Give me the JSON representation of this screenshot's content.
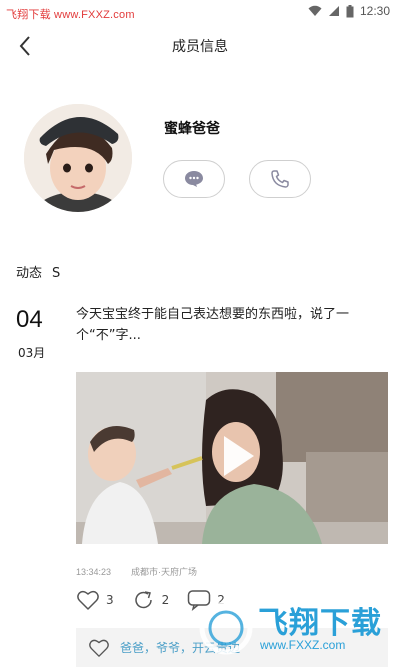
{
  "statusbar": {
    "watermark": "飞翔下载 www.FXXZ.com",
    "time": "12:30"
  },
  "navbar": {
    "title": "成员信息"
  },
  "profile": {
    "name": "蜜蜂爸爸"
  },
  "feed": {
    "label": "动态",
    "count": "S",
    "post": {
      "day": "04",
      "month": "03月",
      "text": "今天宝宝终于能自己表达想要的东西啦，说了一个“不”字...",
      "time": "13:34:23",
      "location": "成都市·天府广场",
      "likes": "3",
      "shares": "2",
      "comments": "2",
      "liked_by": "爸爸，爷爷，开云贵边"
    }
  },
  "overlay_watermark": {
    "text": "飞翔下载",
    "url": "www.FXXZ.com"
  },
  "colors": {
    "accent": "#4ea0c8",
    "watermark_blue": "#2aa0d8",
    "watermark_red": "#e23b3b"
  }
}
